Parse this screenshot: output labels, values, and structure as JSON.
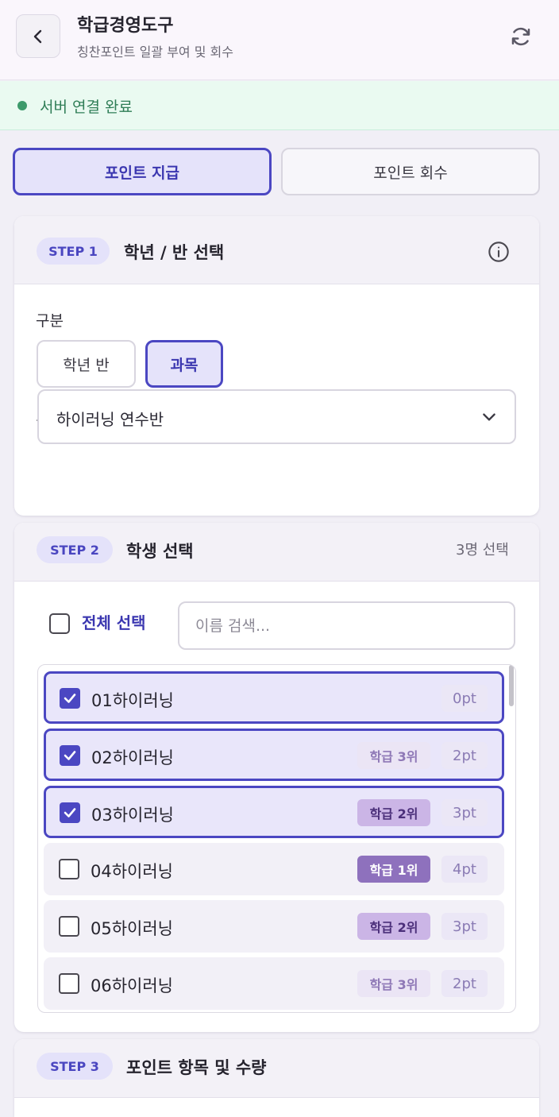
{
  "header": {
    "title": "학급경영도구",
    "subtitle": "칭찬포인트 일괄 부여 및 회수"
  },
  "status": {
    "text": "서버 연결 완료",
    "color": "#3d9a6b"
  },
  "mode_tabs": [
    {
      "label": "포인트 지급",
      "active": true
    },
    {
      "label": "포인트 회수",
      "active": false
    }
  ],
  "step1": {
    "badge": "STEP 1",
    "title": "학년 / 반 선택",
    "category_label": "구분",
    "options": [
      {
        "label": "학년 반",
        "selected": false
      },
      {
        "label": "과목",
        "selected": true
      }
    ],
    "select_label": "선택",
    "selected_value": "하이러닝 연수반"
  },
  "step2": {
    "badge": "STEP 2",
    "title": "학생 선택",
    "count": "3명 선택",
    "select_all": "전체 선택",
    "search_placeholder": "이름 검색...",
    "students": [
      {
        "name": "01하이러닝",
        "checked": true,
        "rank": "",
        "points": "0pt"
      },
      {
        "name": "02하이러닝",
        "checked": true,
        "rank": "학급 3위",
        "points": "2pt"
      },
      {
        "name": "03하이러닝",
        "checked": true,
        "rank": "학급 2위",
        "points": "3pt"
      },
      {
        "name": "04하이러닝",
        "checked": false,
        "rank": "학급 1위",
        "points": "4pt"
      },
      {
        "name": "05하이러닝",
        "checked": false,
        "rank": "학급 2위",
        "points": "3pt"
      },
      {
        "name": "06하이러닝",
        "checked": false,
        "rank": "학급 3위",
        "points": "2pt"
      }
    ]
  },
  "step3": {
    "badge": "STEP 3",
    "title": "포인트 항목 및 수량"
  },
  "colors": {
    "accent": "#4b47c2",
    "rank_1": "#8e71bd",
    "rank_2": "#cbb5e6",
    "rank_3": "#ebe5f5"
  }
}
